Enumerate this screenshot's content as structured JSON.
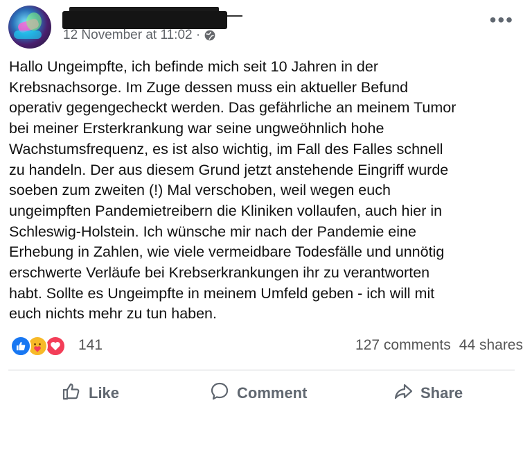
{
  "post": {
    "author_name": "",
    "timestamp": "12 November at 11:02 ·",
    "text": "Hallo Ungeimpfte, ich befinde mich seit 10 Jahren in der\nKrebsnachsorge. Im Zuge dessen muss ein aktueller Befund\noperativ gegengecheckt werden. Das gefährliche an meinem Tumor\nbei meiner Ersterkrankung war seine ungweöhnlich hohe\nWachstumsfrequenz, es ist also wichtig, im Fall des Falles schnell\nzu handeln. Der aus diesem Grund jetzt anstehende Eingriff wurde\nsoeben zum zweiten (!) Mal verschoben, weil wegen euch\nungeimpften Pandemietreibern die Kliniken vollaufen, auch hier in\nSchleswig-Holstein. Ich wünsche mir nach der Pandemie eine\nErhebung in Zahlen, wie viele vermeidbare Todesfälle und unnötig\nerschwerte Verläufe bei Krebserkrankungen ihr zu verantworten\nhabt. Sollte es Ungeimpfte in meinem Umfeld geben - ich will mit\neuch nichts mehr zu tun haben."
  },
  "icons": {
    "more": "more-options-icon",
    "globe": "globe-icon",
    "reactions": [
      "like-reaction-icon",
      "care-reaction-icon",
      "love-reaction-icon"
    ]
  },
  "stats": {
    "reaction_count": "141",
    "comments": "127 comments",
    "shares": "44 shares"
  },
  "actions": {
    "like": "Like",
    "comment": "Comment",
    "share": "Share"
  },
  "colors": {
    "like_blue": "#1877f2",
    "care_yellow": "#f7b928",
    "love_red": "#f33e58",
    "muted_text": "#606770"
  }
}
